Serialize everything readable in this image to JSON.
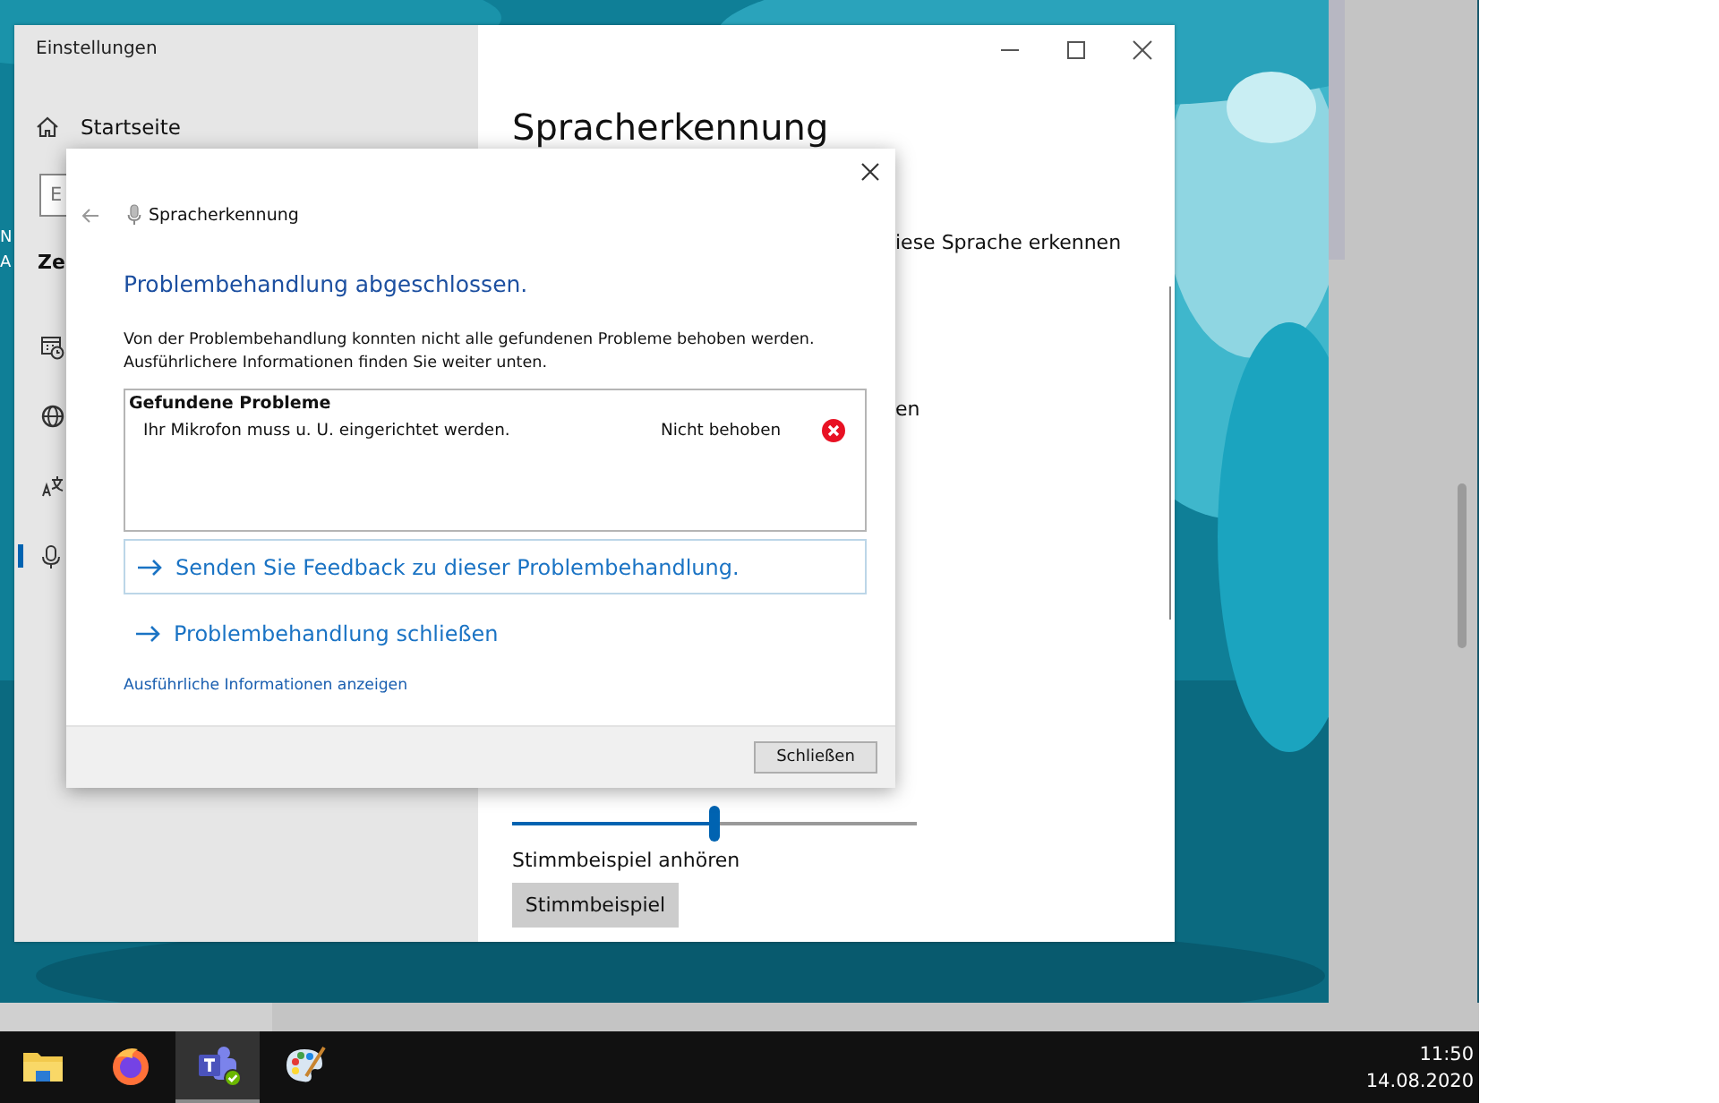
{
  "desktop": {
    "labels": [
      "N",
      "A"
    ]
  },
  "settings_window": {
    "title": "Einstellungen",
    "home": "Startseite",
    "search_placeholder": "E",
    "section": "Ze",
    "sidebar_items": [
      {
        "kind": "calendar",
        "selected": false
      },
      {
        "kind": "globe",
        "selected": false
      },
      {
        "kind": "language",
        "selected": false
      },
      {
        "kind": "mic",
        "selected": true
      }
    ],
    "heading": "Spracherkennung",
    "fragments": [
      "iese Sprache erkennen",
      "en"
    ],
    "speed_slider": {
      "level": 0.5
    },
    "sample_label": "Stimmbeispiel anhören",
    "sample_button": "Stimmbeispiel"
  },
  "dialog": {
    "title": "Spracherkennung",
    "heading": "Problembehandlung abgeschlossen.",
    "description": [
      "Von der Problembehandlung konnten nicht alle gefundenen Probleme behoben werden.",
      "Ausführlichere Informationen finden Sie weiter unten."
    ],
    "problems_title": "Gefundene Probleme",
    "problems": [
      {
        "text": "Ihr Mikrofon muss u. U. eingerichtet werden.",
        "status": "Nicht behoben",
        "fixed": false
      }
    ],
    "feedback_link": "Senden Sie Feedback zu dieser Problembehandlung.",
    "close_link": "Problembehandlung schließen",
    "details_link": "Ausführliche Informationen anzeigen",
    "close_button": "Schließen"
  },
  "taskbar": {
    "apps": [
      {
        "kind": "folder",
        "selected": false
      },
      {
        "kind": "browser",
        "selected": false
      },
      {
        "kind": "teams",
        "selected": true
      },
      {
        "kind": "paint",
        "selected": false
      }
    ],
    "time": "11:50",
    "date": "14.08.2020"
  }
}
